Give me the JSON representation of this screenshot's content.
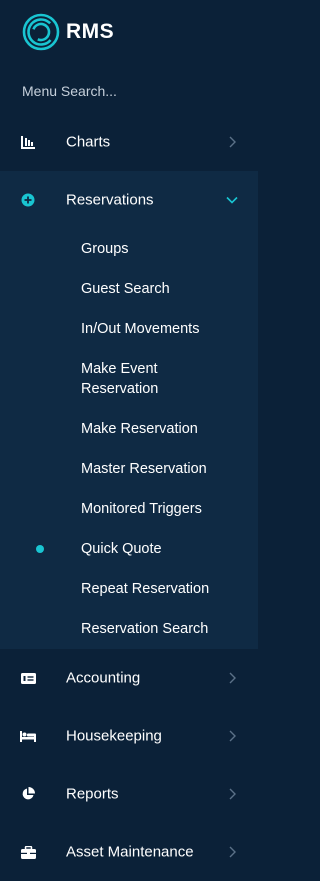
{
  "brand": {
    "name": "RMS",
    "accent_color": "#19c5d2"
  },
  "search": {
    "placeholder": "Menu Search..."
  },
  "nav": {
    "charts": {
      "label": "Charts",
      "icon": "bar-chart-icon"
    },
    "reservations": {
      "label": "Reservations",
      "icon": "plus-circle-icon",
      "expanded": true,
      "children": [
        {
          "label": "Groups"
        },
        {
          "label": "Guest Search"
        },
        {
          "label": "In/Out Movements"
        },
        {
          "label": "Make Event Reservation"
        },
        {
          "label": "Make Reservation"
        },
        {
          "label": "Master Reservation"
        },
        {
          "label": "Monitored Triggers"
        },
        {
          "label": "Quick Quote",
          "active": true
        },
        {
          "label": "Repeat Reservation"
        },
        {
          "label": "Reservation Search"
        }
      ]
    },
    "accounting": {
      "label": "Accounting",
      "icon": "money-icon"
    },
    "housekeeping": {
      "label": "Housekeeping",
      "icon": "bed-icon"
    },
    "reports": {
      "label": "Reports",
      "icon": "pie-chart-icon"
    },
    "asset_maintenance": {
      "label": "Asset Maintenance",
      "icon": "toolbox-icon"
    }
  }
}
